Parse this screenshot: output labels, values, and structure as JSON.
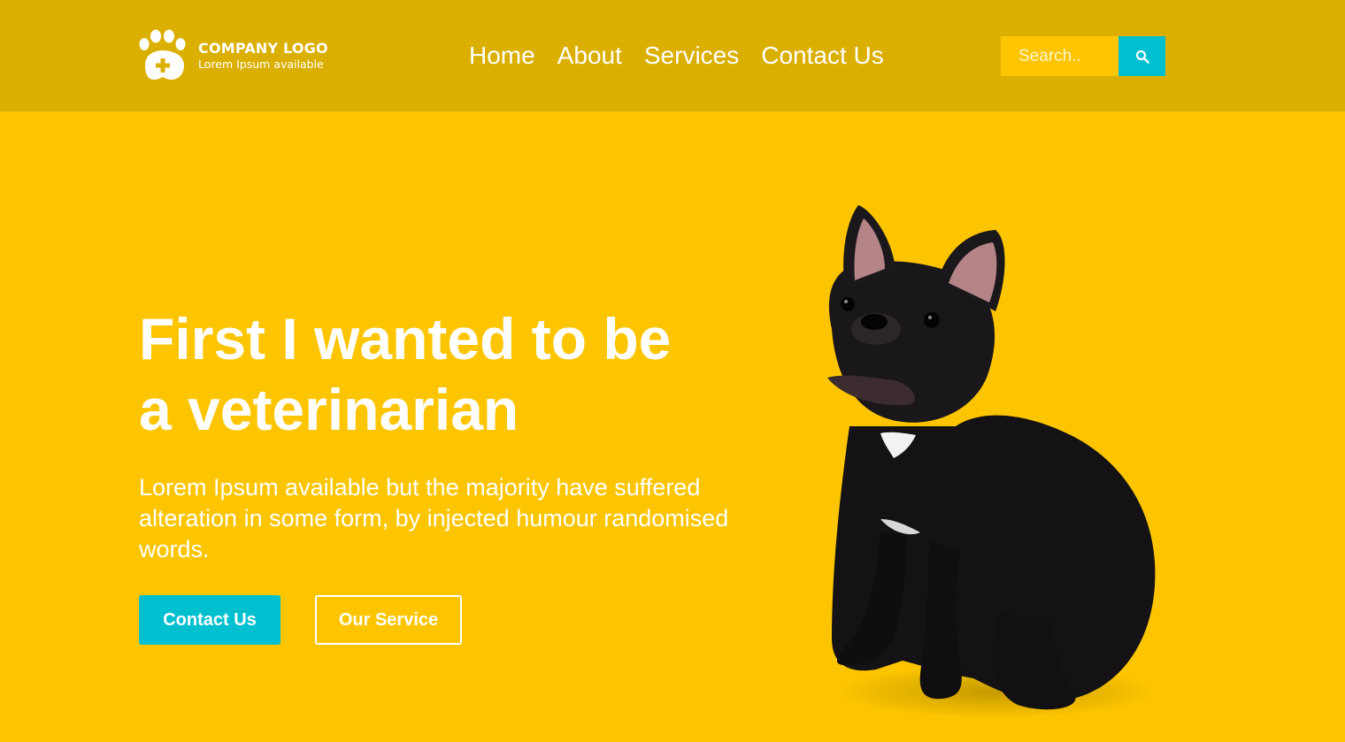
{
  "header": {
    "logo": {
      "title": "COMPANY LOGO",
      "subtitle": "Lorem Ipsum available",
      "icon": "paw-plus-icon"
    },
    "nav": [
      {
        "label": "Home"
      },
      {
        "label": "About"
      },
      {
        "label": "Services"
      },
      {
        "label": "Contact Us"
      }
    ],
    "search": {
      "placeholder": "Search..",
      "value": "",
      "icon": "search-icon"
    }
  },
  "hero": {
    "title_line1": "First I wanted to be",
    "title_line2": "a veterinarian",
    "text": "Lorem Ipsum available but the majority have suffered alteration in some form, by injected humour randomised words.",
    "primary_button": "Contact Us",
    "secondary_button": "Our Service",
    "image": "french-bulldog-image"
  },
  "colors": {
    "header_bg": "#dbaf00",
    "page_bg": "#fcc500",
    "accent": "#00bfcf",
    "text": "#ffffff"
  }
}
